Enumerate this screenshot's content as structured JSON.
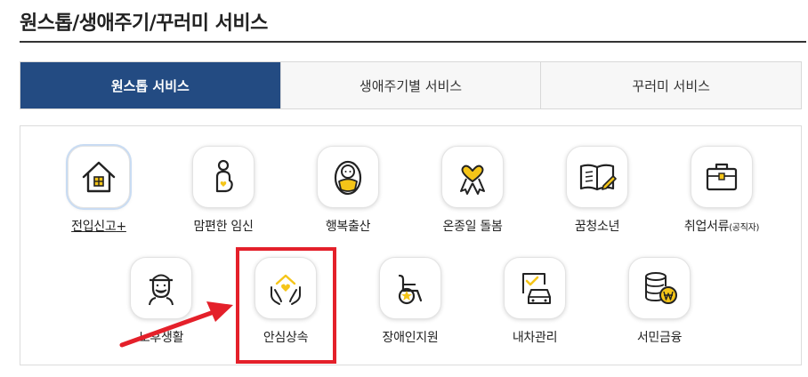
{
  "header": {
    "title": "원스톱/생애주기/꾸러미 서비스"
  },
  "tabs": [
    {
      "label": "원스톱 서비스",
      "active": true
    },
    {
      "label": "생애주기별 서비스",
      "active": false
    },
    {
      "label": "꾸러미 서비스",
      "active": false
    }
  ],
  "services_row1": [
    {
      "label": "전입신고",
      "suffix": "+",
      "icon": "house-icon"
    },
    {
      "label": "맘편한 임신",
      "icon": "pregnancy-icon"
    },
    {
      "label": "행복출산",
      "icon": "baby-icon"
    },
    {
      "label": "온종일 돌봄",
      "icon": "care-ribbon-icon"
    },
    {
      "label": "꿈청소년",
      "icon": "book-icon"
    },
    {
      "label": "취업서류",
      "suffix": "(공직자)",
      "icon": "briefcase-icon"
    }
  ],
  "services_row2": [
    {
      "label": "노후생활",
      "icon": "elderly-icon"
    },
    {
      "label": "안심상속",
      "icon": "hands-heart-house-icon"
    },
    {
      "label": "장애인지원",
      "icon": "wheelchair-icon"
    },
    {
      "label": "내차관리",
      "icon": "car-document-icon"
    },
    {
      "label": "서민금융",
      "icon": "coins-icon"
    }
  ],
  "colors": {
    "navy": "#234b82",
    "accent_yellow": "#f5c518",
    "highlight_red": "#e4202a"
  }
}
